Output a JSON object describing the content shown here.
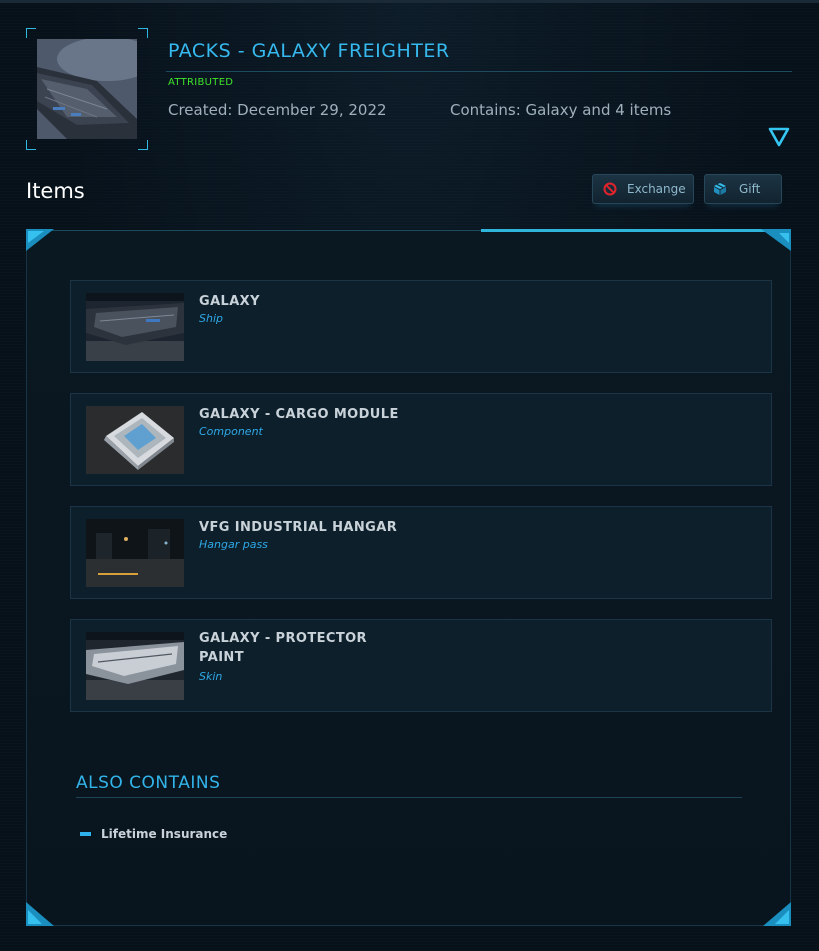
{
  "pledge": {
    "title": "PACKS - GALAXY FREIGHTER",
    "status": "ATTRIBUTED",
    "created": "Created: December 29, 2022",
    "contains": "Contains: Galaxy and 4 items"
  },
  "items_section": {
    "title": "Items",
    "exchange_label": "Exchange",
    "gift_label": "Gift",
    "items": [
      {
        "name": "GALAXY",
        "type": "Ship"
      },
      {
        "name": "GALAXY - CARGO MODULE",
        "type": "Component"
      },
      {
        "name": "VFG INDUSTRIAL HANGAR",
        "type": "Hangar pass"
      },
      {
        "name": "GALAXY - PROTECTOR PAINT",
        "type": "Skin"
      }
    ]
  },
  "also_contains": {
    "title": "ALSO CONTAINS",
    "items": [
      "Lifetime Insurance"
    ]
  },
  "colors": {
    "accent": "#36b9ee",
    "attributed": "#3ee32a",
    "exchange_icon": "#e0242c"
  },
  "icons": {
    "expand": "chevron-down-triangle-icon",
    "exchange": "no-entry-icon",
    "gift": "gift-box-icon"
  }
}
